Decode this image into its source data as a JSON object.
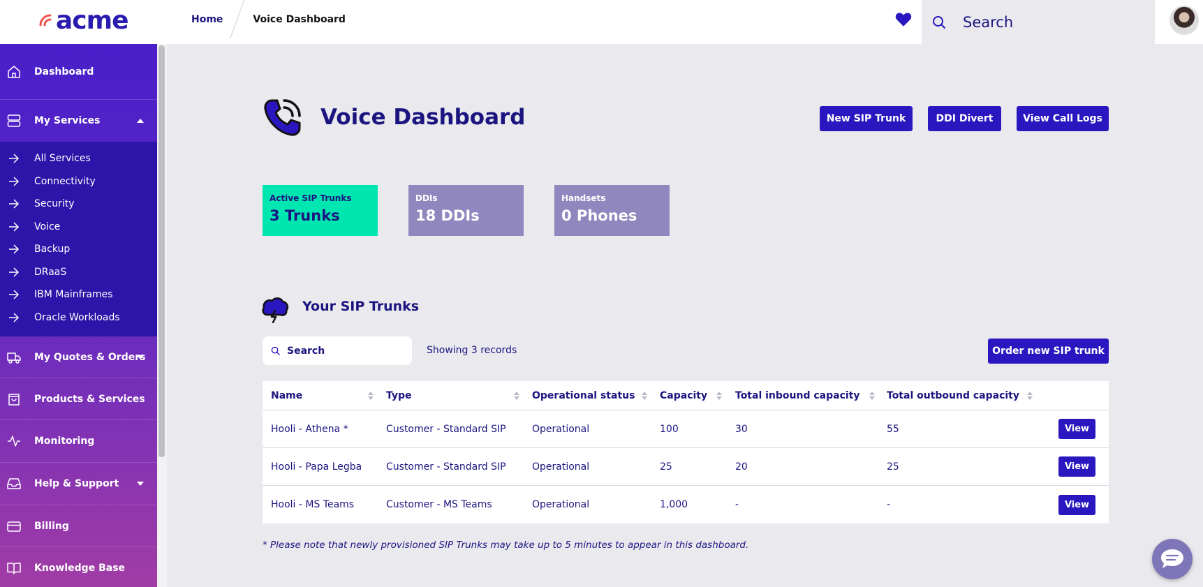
{
  "header": {
    "logo_text": "acme",
    "breadcrumb": {
      "home": "Home",
      "current": "Voice Dashboard"
    },
    "search_placeholder": "Search",
    "icons": {
      "favorites": "heart-icon",
      "search": "search-icon",
      "avatar": "user-avatar"
    }
  },
  "sidebar": {
    "items": [
      {
        "label": "Dashboard",
        "icon": "home-icon"
      },
      {
        "label": "My Services",
        "icon": "server-icon",
        "expanded": true
      },
      {
        "label": "My Quotes & Orders",
        "icon": "truck-icon",
        "has_submenu": true
      },
      {
        "label": "Products & Services",
        "icon": "shopping-bag-icon"
      },
      {
        "label": "Monitoring",
        "icon": "activity-icon"
      },
      {
        "label": "Help & Support",
        "icon": "inbox-icon",
        "has_submenu": true
      },
      {
        "label": "Billing",
        "icon": "credit-card-icon"
      },
      {
        "label": "Knowledge Base",
        "icon": "book-icon"
      }
    ],
    "my_services_subitems": [
      "All Services",
      "Connectivity",
      "Security",
      "Voice",
      "Backup",
      "DRaaS",
      "IBM Mainframes",
      "Oracle Workloads"
    ]
  },
  "main": {
    "title": "Voice Dashboard",
    "buttons": {
      "new_sip_trunk": "New SIP Trunk",
      "ddi_divert": "DDI Divert",
      "view_call_logs": "View Call Logs"
    },
    "stats": [
      {
        "label": "Active SIP Trunks",
        "value": "3 Trunks"
      },
      {
        "label": "DDIs",
        "value": "18 DDIs"
      },
      {
        "label": "Handsets",
        "value": "0 Phones"
      }
    ],
    "section_title": "Your SIP Trunks",
    "table_search_placeholder": "Search",
    "showing_text": "Showing 3 records",
    "order_button": "Order new SIP trunk",
    "table": {
      "columns": [
        "Name",
        "Type",
        "Operational status",
        "Capacity",
        "Total inbound capacity",
        "Total outbound capacity"
      ],
      "rows": [
        {
          "name": "Hooli - Athena *",
          "type": "Customer - Standard SIP",
          "status": "Operational",
          "capacity": "100",
          "inbound": "30",
          "outbound": "55",
          "action": "View"
        },
        {
          "name": "Hooli - Papa Legba",
          "type": "Customer - Standard SIP",
          "status": "Operational",
          "capacity": "25",
          "inbound": "20",
          "outbound": "25",
          "action": "View"
        },
        {
          "name": "Hooli - MS Teams",
          "type": "Customer - MS Teams",
          "status": "Operational",
          "capacity": "1,000",
          "inbound": "-",
          "outbound": "-",
          "action": "View"
        }
      ]
    },
    "footnote": "* Please note that newly provisioned SIP Trunks may take up to 5 minutes to appear in this dashboard."
  },
  "colors": {
    "brand": "#2a17c0",
    "text": "#1c1580",
    "active_stat": "#00e6b0",
    "muted_stat": "#8f87bd",
    "logo_accent": "#f0544f"
  }
}
